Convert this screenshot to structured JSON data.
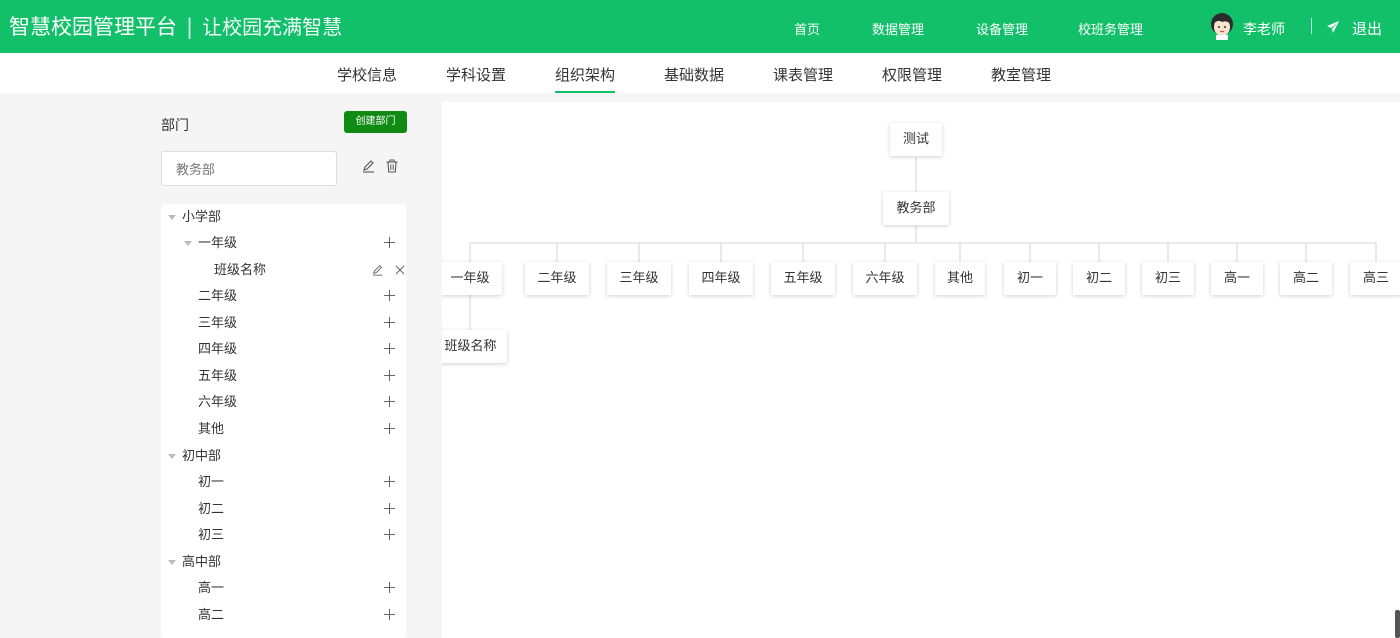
{
  "header": {
    "brand_title": "智慧校园管理平台",
    "brand_separator": "|",
    "brand_slogan": "让校园充满智慧",
    "nav": [
      "首页",
      "数据管理",
      "设备管理",
      "校班务管理"
    ],
    "user_name": "李老师",
    "logout_label": "退出",
    "bg_color": "#12c06a"
  },
  "subnav": {
    "tabs": [
      "学校信息",
      "学科设置",
      "组织架构",
      "基础数据",
      "课表管理",
      "权限管理",
      "教室管理"
    ],
    "active": "组织架构"
  },
  "left_panel": {
    "title": "部门",
    "create_button": "创建部门",
    "current_department": "教务部",
    "tree": [
      {
        "label": "小学部",
        "expanded": true
      },
      {
        "label": "一年级",
        "expanded": true
      },
      {
        "label": "班级名称"
      },
      {
        "label": "二年级"
      },
      {
        "label": "三年级"
      },
      {
        "label": "四年级"
      },
      {
        "label": "五年级"
      },
      {
        "label": "六年级"
      },
      {
        "label": "其他"
      },
      {
        "label": "初中部",
        "expanded": true
      },
      {
        "label": "初一"
      },
      {
        "label": "初二"
      },
      {
        "label": "初三"
      },
      {
        "label": "高中部",
        "expanded": true
      },
      {
        "label": "高一"
      },
      {
        "label": "高二"
      }
    ]
  },
  "org_chart": {
    "root": "测试",
    "department": "教务部",
    "children": [
      "一年级",
      "二年级",
      "三年级",
      "四年级",
      "五年级",
      "六年级",
      "其他",
      "初一",
      "初二",
      "初三",
      "高一",
      "高二",
      "高三"
    ],
    "grandchild": "班级名称"
  }
}
